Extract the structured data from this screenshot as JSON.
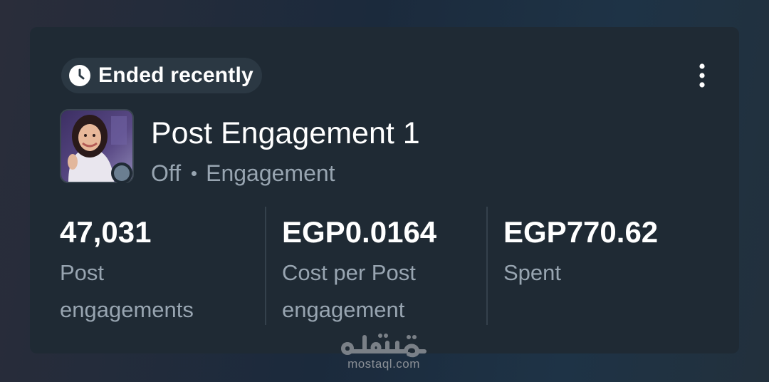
{
  "status": {
    "label": "Ended recently",
    "icon": "clock-icon"
  },
  "menu": {
    "icon": "more-vertical-icon"
  },
  "campaign": {
    "title": "Post Engagement 1",
    "state": "Off",
    "objective": "Engagement",
    "status_dot_color": "#6b7f91"
  },
  "metrics": [
    {
      "value": "47,031",
      "label": "Post engagements"
    },
    {
      "value": "EGP0.0164",
      "label": "Cost per Post engagement"
    },
    {
      "value": "EGP770.62",
      "label": "Spent"
    }
  ],
  "watermark": {
    "site": "mostaql.com",
    "logo_text": "مستقل"
  },
  "colors": {
    "card_bg": "#1f2a34",
    "pill_bg": "#2b3843",
    "primary_text": "#ffffff",
    "secondary_text": "#98a5b1",
    "divider": "#34414c"
  }
}
